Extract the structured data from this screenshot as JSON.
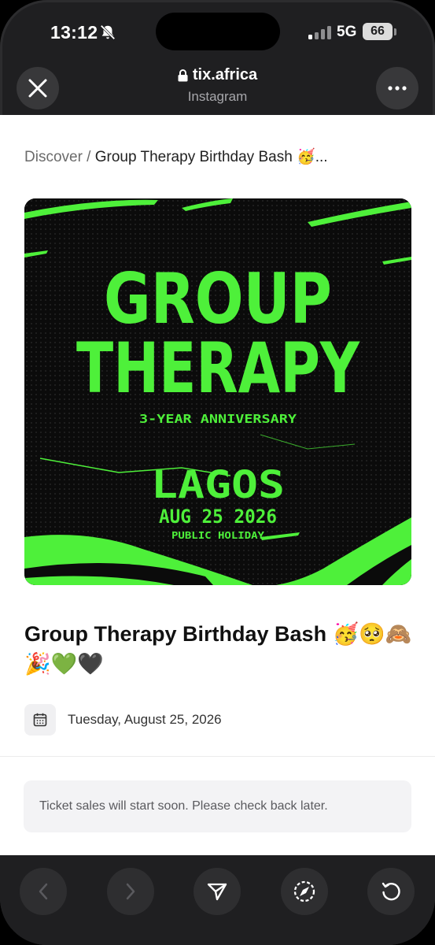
{
  "status_bar": {
    "time": "13:12",
    "network": "5G",
    "battery": "66"
  },
  "browser": {
    "url": "tix.africa",
    "source": "Instagram"
  },
  "breadcrumb": {
    "root": "Discover",
    "separator": " / ",
    "current": "Group Therapy Birthday Bash 🥳..."
  },
  "poster": {
    "line1": "GROUP",
    "line2": "THERAPY",
    "subtitle": "3-YEAR ANNIVERSARY",
    "city": "LAGOS",
    "date": "AUG 25 2026",
    "note": "PUBLIC HOLIDAY",
    "accent_color": "#4ef03a",
    "background_color": "#0b0b0b"
  },
  "event": {
    "title": "Group Therapy Birthday Bash 🥳🥺🙈 🎉💚🖤",
    "date": "Tuesday, August 25, 2026"
  },
  "notice": "Ticket sales will start soon. Please check back later.",
  "icons": {
    "status": [
      "bell-slash-icon",
      "signal-icon",
      "battery-icon"
    ],
    "header": [
      "close-icon",
      "lock-icon",
      "more-icon"
    ],
    "toolbar": [
      "back-icon",
      "forward-icon",
      "share-icon",
      "compass-icon",
      "refresh-icon"
    ]
  }
}
